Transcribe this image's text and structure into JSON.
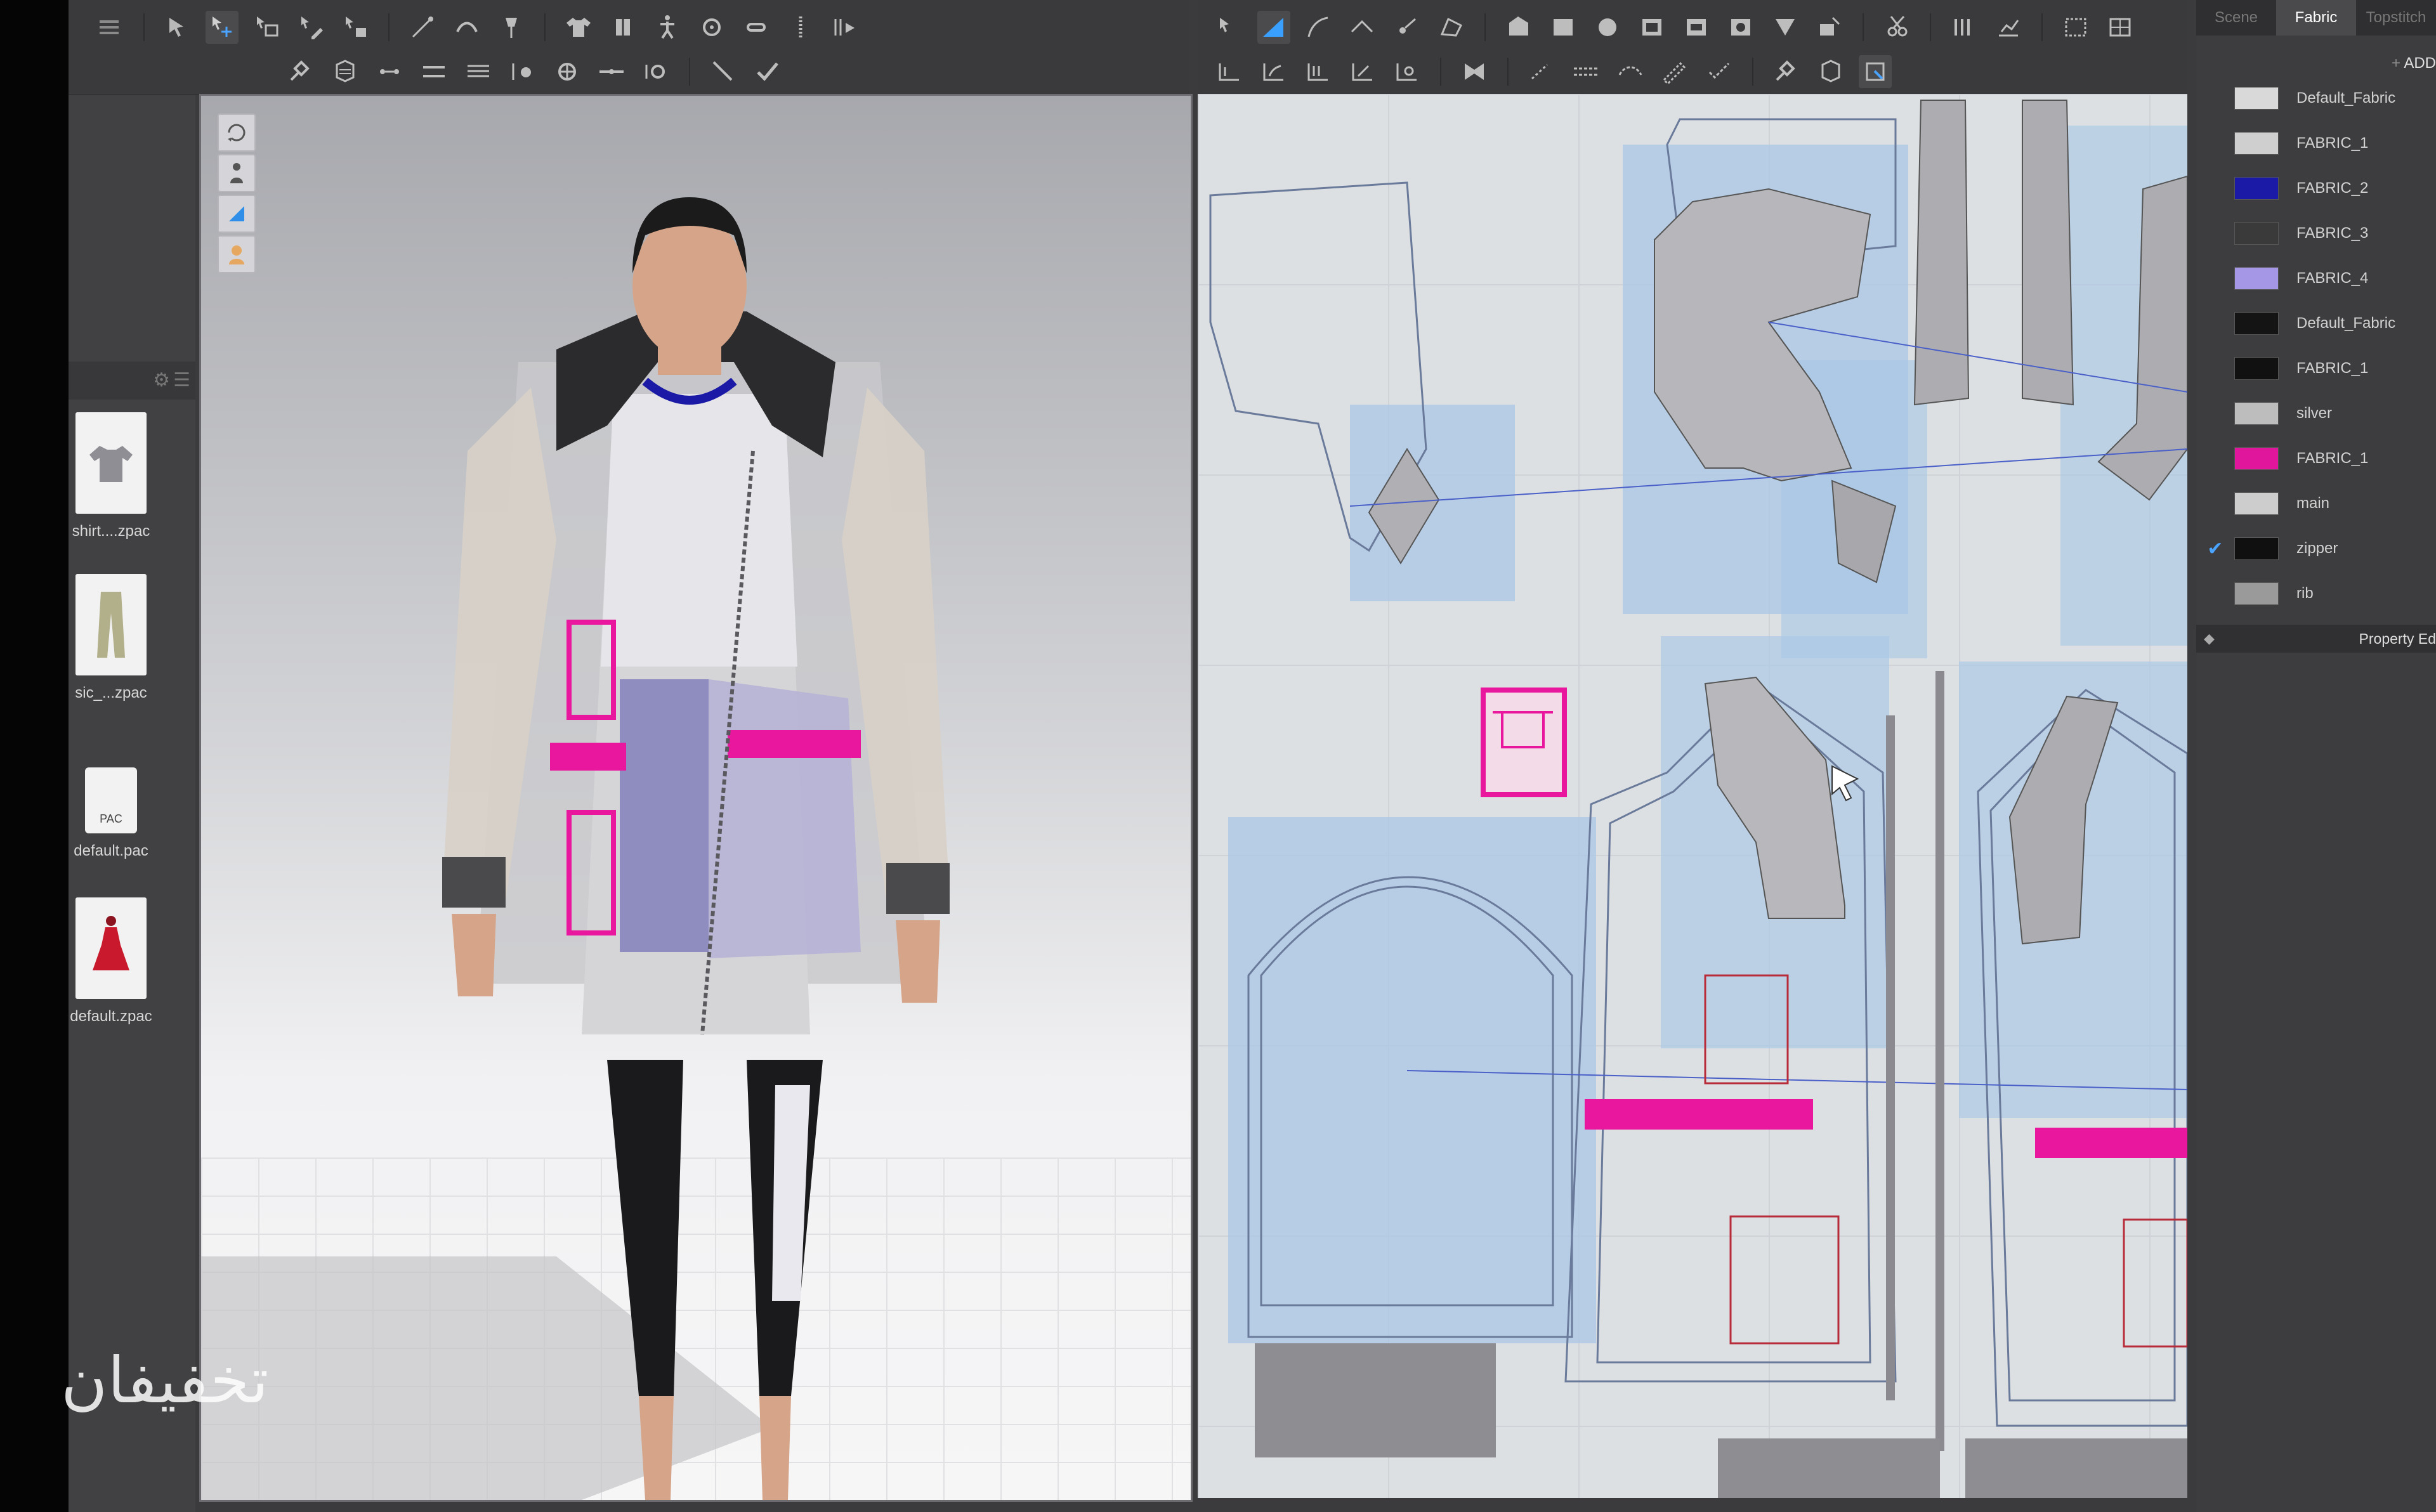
{
  "library": {
    "items": [
      {
        "label": "shirt....zpac",
        "icon": "tshirt-icon"
      },
      {
        "label": "sic_...zpac",
        "icon": "pants-icon"
      },
      {
        "label": "default.pac",
        "icon": "file-icon",
        "file_tag": "PAC"
      },
      {
        "label": "default.zpac",
        "icon": "dress-icon"
      }
    ]
  },
  "right_panel": {
    "tabs": [
      "Scene",
      "Fabric",
      "Topstitch"
    ],
    "active_tab": "Fabric",
    "add_label": "ADD",
    "fabrics": [
      {
        "name": "Default_Fabric",
        "color": "#d9d9d9",
        "checked": false
      },
      {
        "name": "FABRIC_1",
        "color": "#cfcfcf",
        "checked": false
      },
      {
        "name": "FABRIC_2",
        "color": "#1a1aa6",
        "checked": false
      },
      {
        "name": "FABRIC_3",
        "color": "#3a3a3a",
        "checked": false
      },
      {
        "name": "FABRIC_4",
        "color": "#a597e6",
        "checked": false
      },
      {
        "name": "Default_Fabric",
        "color": "#141414",
        "checked": false
      },
      {
        "name": "FABRIC_1",
        "color": "#111111",
        "checked": false
      },
      {
        "name": "silver",
        "color": "#bdbdbd",
        "checked": false
      },
      {
        "name": "FABRIC_1",
        "color": "#e0179c",
        "checked": false
      },
      {
        "name": "main",
        "color": "#cdcdcd",
        "checked": false
      },
      {
        "name": "zipper",
        "color": "#101010",
        "checked": true
      },
      {
        "name": "rib",
        "color": "#9a9a9a",
        "checked": false
      }
    ],
    "property_editor_label": "Property Ed"
  },
  "colors": {
    "accent_pink": "#e8179e",
    "pattern_blue": "#a9c7e6",
    "panel_bg": "#3d3d3f"
  },
  "watermark": "تخفیفان"
}
